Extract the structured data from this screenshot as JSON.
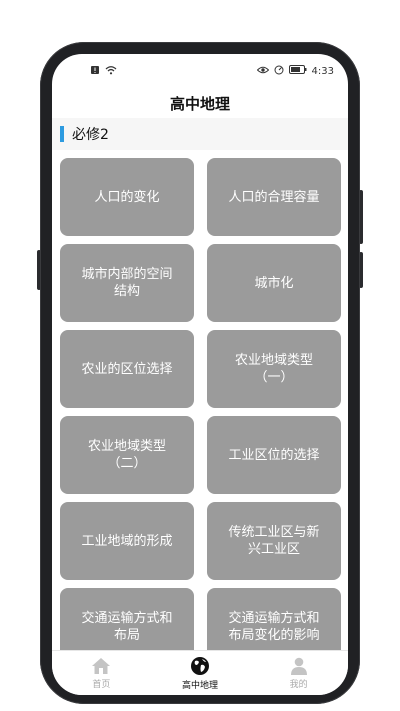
{
  "status": {
    "time": "4:33"
  },
  "app": {
    "title": "高中地理"
  },
  "section": {
    "title": "必修2"
  },
  "tiles": [
    "人口的变化",
    "人口的合理容量",
    "城市内部的空间\n结构",
    "城市化",
    "农业的区位选择",
    "农业地域类型\n（一）",
    "农业地域类型\n（二）",
    "工业区位的选择",
    "工业地域的形成",
    "传统工业区与新\n兴工业区",
    "交通运输方式和\n布局",
    "交通运输方式和\n布局变化的影响"
  ],
  "tabs": [
    {
      "label": "首页",
      "icon": "home-icon"
    },
    {
      "label": "高中地理",
      "icon": "globe-icon"
    },
    {
      "label": "我的",
      "icon": "user-icon"
    }
  ],
  "colors": {
    "tile": "#9b9b9b",
    "accent": "#2d9be0"
  }
}
